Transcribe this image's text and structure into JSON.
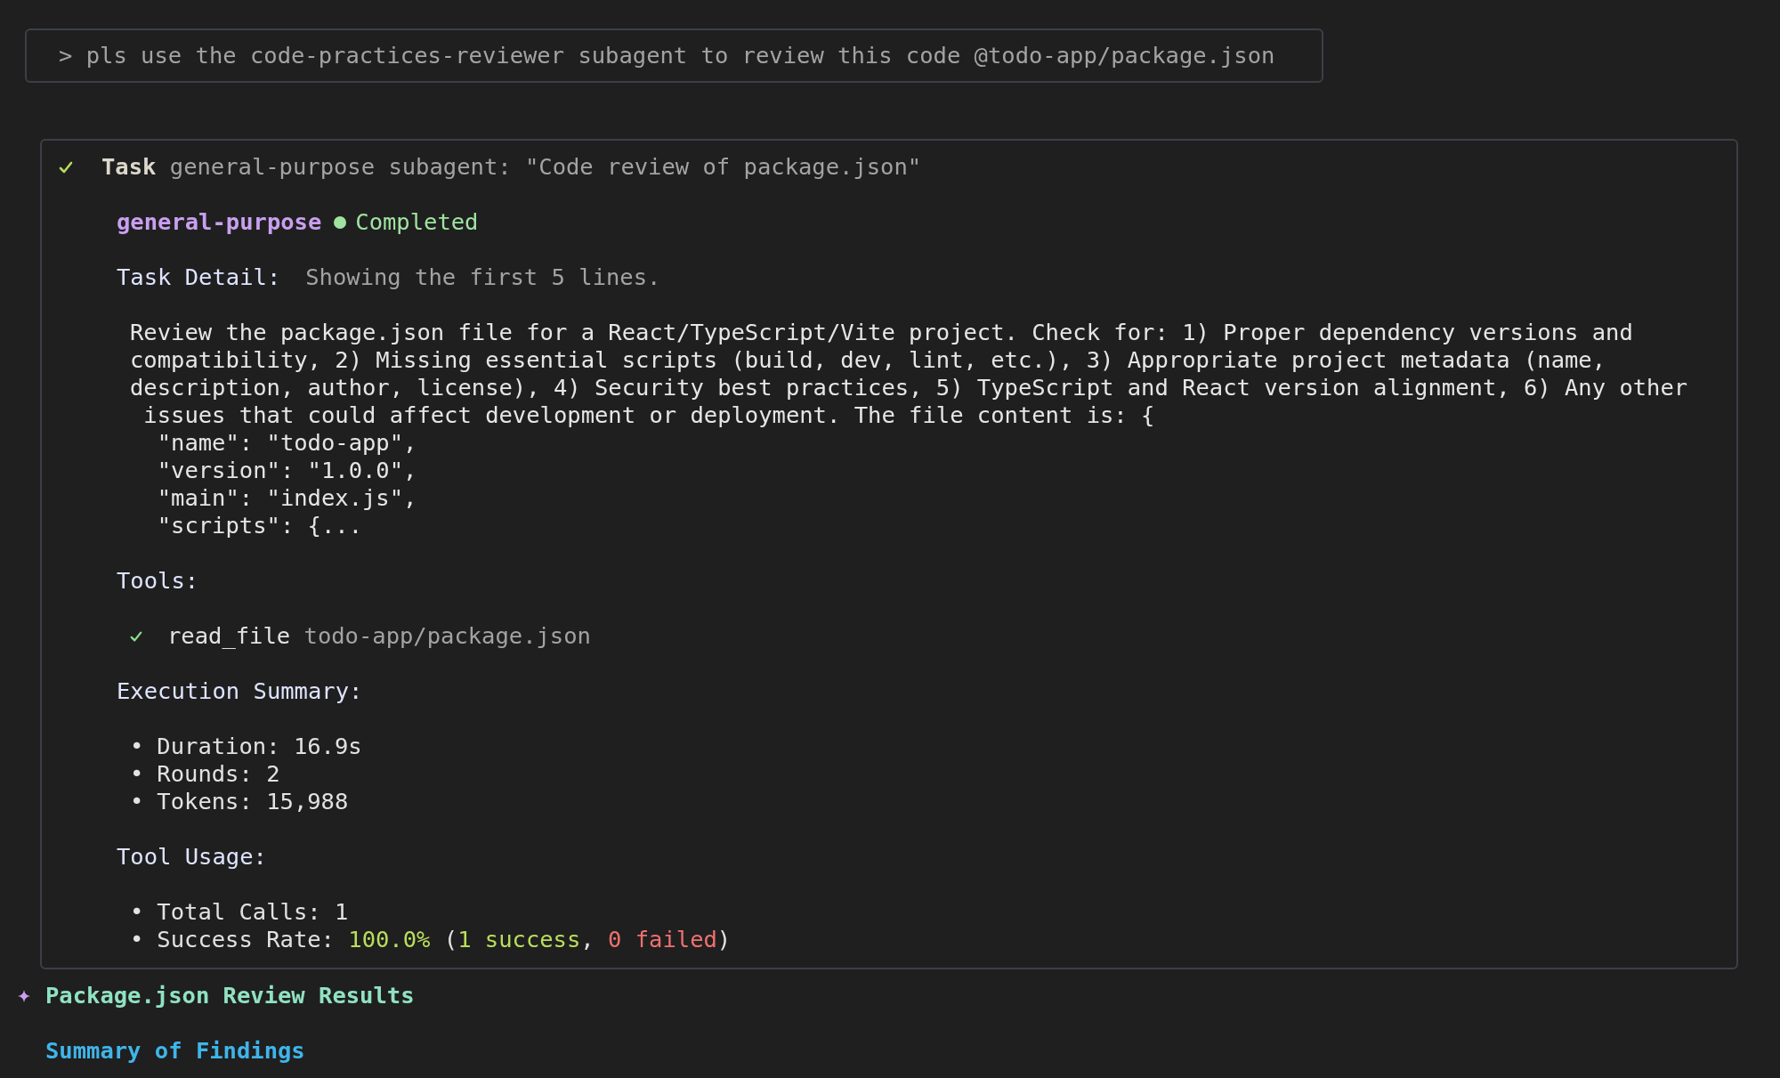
{
  "prompt": "> pls use the code-practices-reviewer subagent to review this code @todo-app/package.json",
  "task": {
    "completed": true,
    "title": "Task",
    "description": "general-purpose subagent: \"Code review of package.json\"",
    "agent": {
      "name": "general-purpose",
      "status": "Completed",
      "completed": true
    },
    "detail": {
      "label": "Task Detail:",
      "note": "Showing the first 5 lines.",
      "text": "Review the package.json file for a React/TypeScript/Vite project. Check for: 1) Proper dependency versions and\ncompatibility, 2) Missing essential scripts (build, dev, lint, etc.), 3) Appropriate project metadata (name,\ndescription, author, license), 4) Security best practices, 5) TypeScript and React version alignment, 6) Any other\n issues that could affect development or deployment. The file content is: {\n  \"name\": \"todo-app\",\n  \"version\": \"1.0.0\",\n  \"main\": \"index.js\",\n  \"scripts\": {..."
    },
    "tools": {
      "label": "Tools:",
      "items": [
        {
          "name": "read_file",
          "args": "todo-app/package.json",
          "succeeded": true
        }
      ]
    },
    "execution_summary": {
      "label": "Execution Summary:",
      "bullet": "•",
      "items": [
        {
          "parts": [
            {
              "text": "Duration: 16.9s",
              "kind": "plain"
            }
          ]
        },
        {
          "parts": [
            {
              "text": "Rounds: 2",
              "kind": "plain"
            }
          ]
        },
        {
          "parts": [
            {
              "text": "Tokens: 15,988",
              "kind": "plain"
            }
          ]
        }
      ]
    },
    "tool_usage": {
      "label": "Tool Usage:",
      "bullet": "•",
      "items": [
        {
          "parts": [
            {
              "text": "Total Calls: 1",
              "kind": "plain"
            }
          ]
        },
        {
          "parts": [
            {
              "text": "Success Rate: ",
              "kind": "plain"
            },
            {
              "text": "100.0%",
              "kind": "good"
            },
            {
              "text": " (",
              "kind": "plain"
            },
            {
              "text": "1 success",
              "kind": "good"
            },
            {
              "text": ", ",
              "kind": "plain"
            },
            {
              "text": "0 failed",
              "kind": "bad"
            },
            {
              "text": ")",
              "kind": "plain"
            }
          ]
        }
      ]
    }
  },
  "results": {
    "title": "Package.json Review Results",
    "subtitle": "Summary of Findings"
  }
}
